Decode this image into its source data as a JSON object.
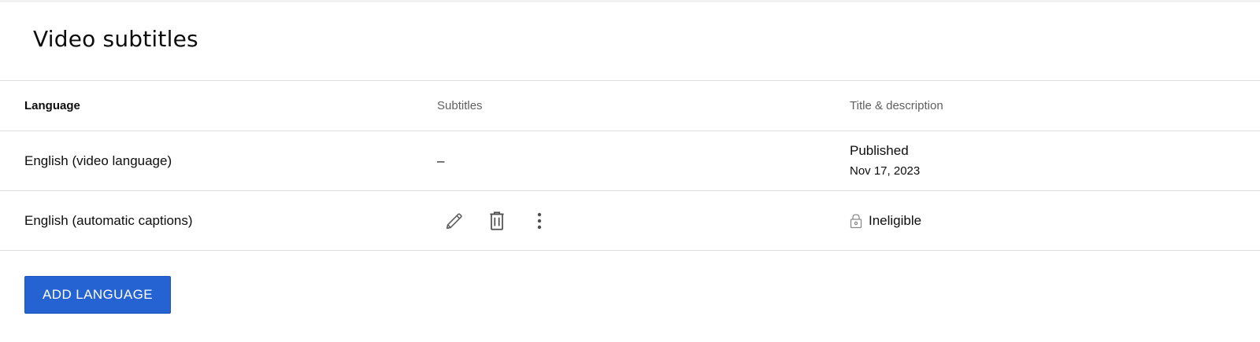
{
  "page": {
    "title": "Video subtitles"
  },
  "table": {
    "headers": {
      "language": "Language",
      "subtitles": "Subtitles",
      "title_description": "Title & description"
    },
    "rows": [
      {
        "language": "English (video language)",
        "subtitles": "–",
        "title_description_status": "Published",
        "title_description_date": "Nov 17, 2023"
      },
      {
        "language": "English (automatic captions)",
        "subtitles_actions": [
          "edit-icon",
          "delete-icon",
          "more-options-icon"
        ],
        "title_description_status": "Ineligible",
        "title_description_icon": "lock-icon"
      }
    ]
  },
  "footer": {
    "add_language_label": "ADD LANGUAGE"
  },
  "colors": {
    "primary_button": "#2563d2",
    "divider": "#e0e0e0",
    "muted_text": "#606060"
  }
}
